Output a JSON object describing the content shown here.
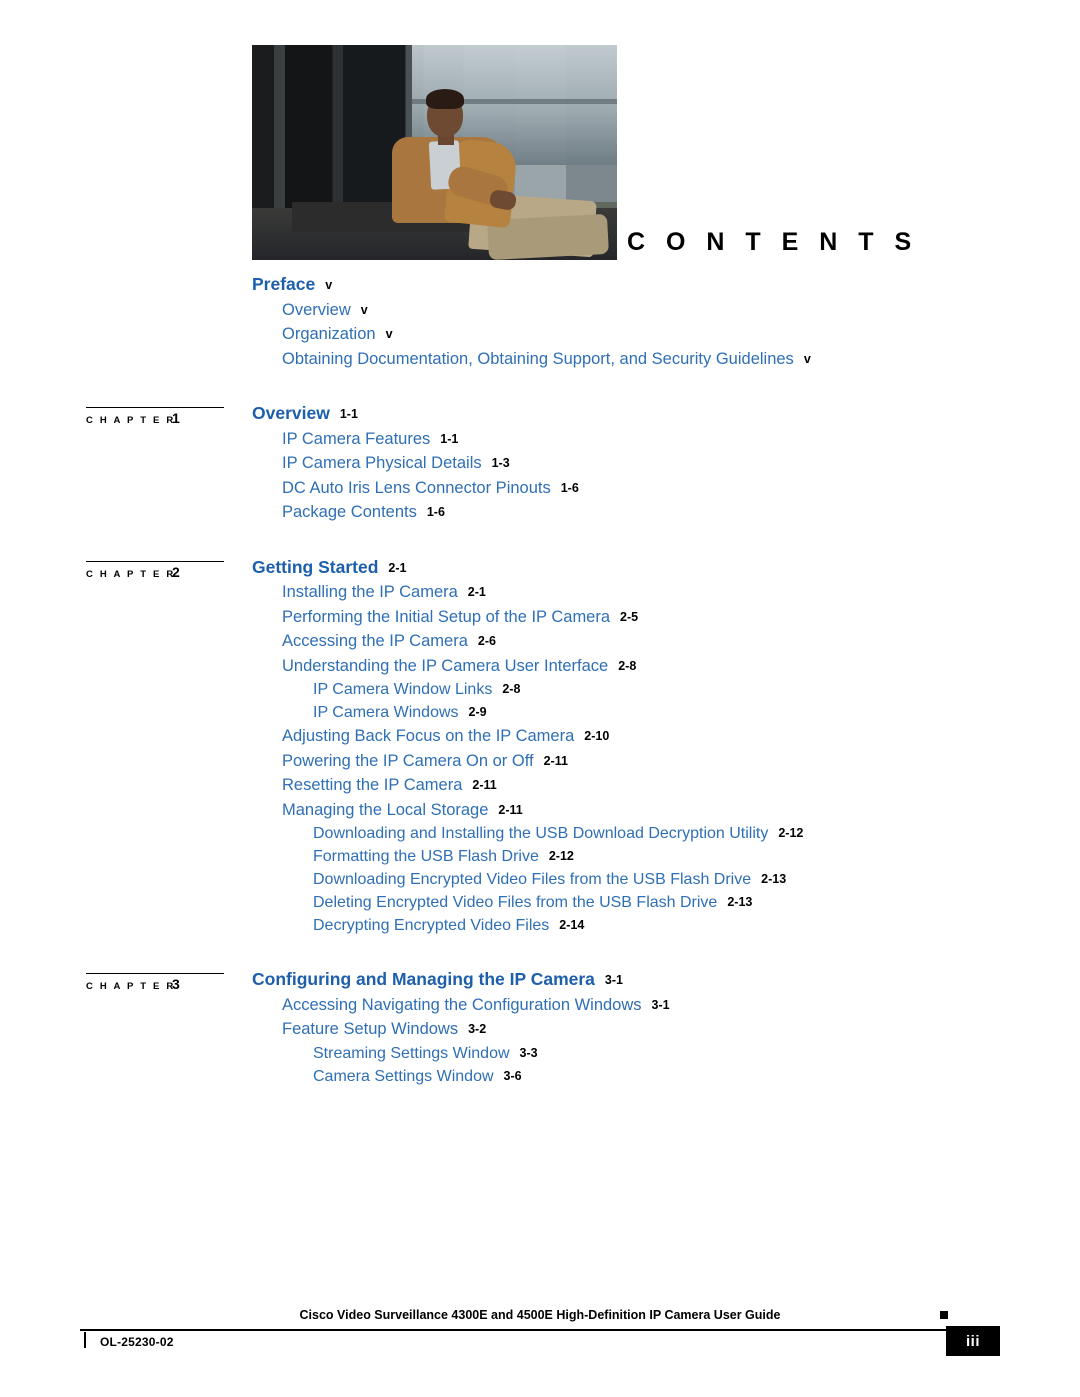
{
  "page": {
    "heading": "C O N T E N T S",
    "folio": "iii",
    "footer_title": "Cisco Video Surveillance 4300E and 4500E High‑Definition IP Camera User Guide",
    "footer_doc_id": "OL-25230-02"
  },
  "labels": {
    "chapter_word": "C H A P T E R"
  },
  "colors": {
    "heading_blue": "#1d5fab",
    "entry_blue": "#2f6fb5",
    "page_number": "#000000"
  },
  "toc": [
    {
      "kind": "part",
      "title": "Preface",
      "page": "v",
      "children": [
        {
          "level": 1,
          "title": "Overview",
          "page": "v"
        },
        {
          "level": 1,
          "title": "Organization",
          "page": "v"
        },
        {
          "level": 1,
          "title": "Obtaining Documentation, Obtaining Support, and Security Guidelines",
          "page": "v"
        }
      ]
    },
    {
      "kind": "chapter",
      "number": "1",
      "title": "Overview",
      "page": "1-1",
      "children": [
        {
          "level": 1,
          "title": "IP Camera Features",
          "page": "1-1"
        },
        {
          "level": 1,
          "title": "IP Camera Physical Details",
          "page": "1-3"
        },
        {
          "level": 1,
          "title": "DC Auto Iris Lens Connector Pinouts",
          "page": "1-6"
        },
        {
          "level": 1,
          "title": "Package Contents",
          "page": "1-6"
        }
      ]
    },
    {
      "kind": "chapter",
      "number": "2",
      "title": "Getting Started",
      "page": "2-1",
      "children": [
        {
          "level": 1,
          "title": "Installing the IP Camera",
          "page": "2-1"
        },
        {
          "level": 1,
          "title": "Performing the Initial Setup of the IP Camera",
          "page": "2-5"
        },
        {
          "level": 1,
          "title": "Accessing the IP Camera",
          "page": "2-6"
        },
        {
          "level": 1,
          "title": "Understanding the IP Camera User Interface",
          "page": "2-8"
        },
        {
          "level": 2,
          "title": "IP Camera Window Links",
          "page": "2-8"
        },
        {
          "level": 2,
          "title": "IP Camera Windows",
          "page": "2-9"
        },
        {
          "level": 1,
          "title": "Adjusting Back Focus on the IP Camera",
          "page": "2-10"
        },
        {
          "level": 1,
          "title": "Powering the IP Camera On or Off",
          "page": "2-11"
        },
        {
          "level": 1,
          "title": "Resetting the IP Camera",
          "page": "2-11"
        },
        {
          "level": 1,
          "title": "Managing the Local Storage",
          "page": "2-11"
        },
        {
          "level": 2,
          "title": "Downloading and Installing the USB Download Decryption Utility",
          "page": "2-12"
        },
        {
          "level": 2,
          "title": "Formatting the USB Flash Drive",
          "page": "2-12"
        },
        {
          "level": 2,
          "title": "Downloading Encrypted Video Files from the USB Flash Drive",
          "page": "2-13"
        },
        {
          "level": 2,
          "title": "Deleting Encrypted Video Files from the USB Flash Drive",
          "page": "2-13"
        },
        {
          "level": 2,
          "title": "Decrypting Encrypted Video Files",
          "page": "2-14"
        }
      ]
    },
    {
      "kind": "chapter",
      "number": "3",
      "title": "Configuring and Managing the IP Camera",
      "page": "3-1",
      "children": [
        {
          "level": 1,
          "title": "Accessing Navigating the Configuration Windows",
          "page": "3-1"
        },
        {
          "level": 1,
          "title": "Feature Setup Windows",
          "page": "3-2"
        },
        {
          "level": 2,
          "title": "Streaming Settings Window",
          "page": "3-3"
        },
        {
          "level": 2,
          "title": "Camera Settings Window",
          "page": "3-6"
        }
      ]
    }
  ]
}
